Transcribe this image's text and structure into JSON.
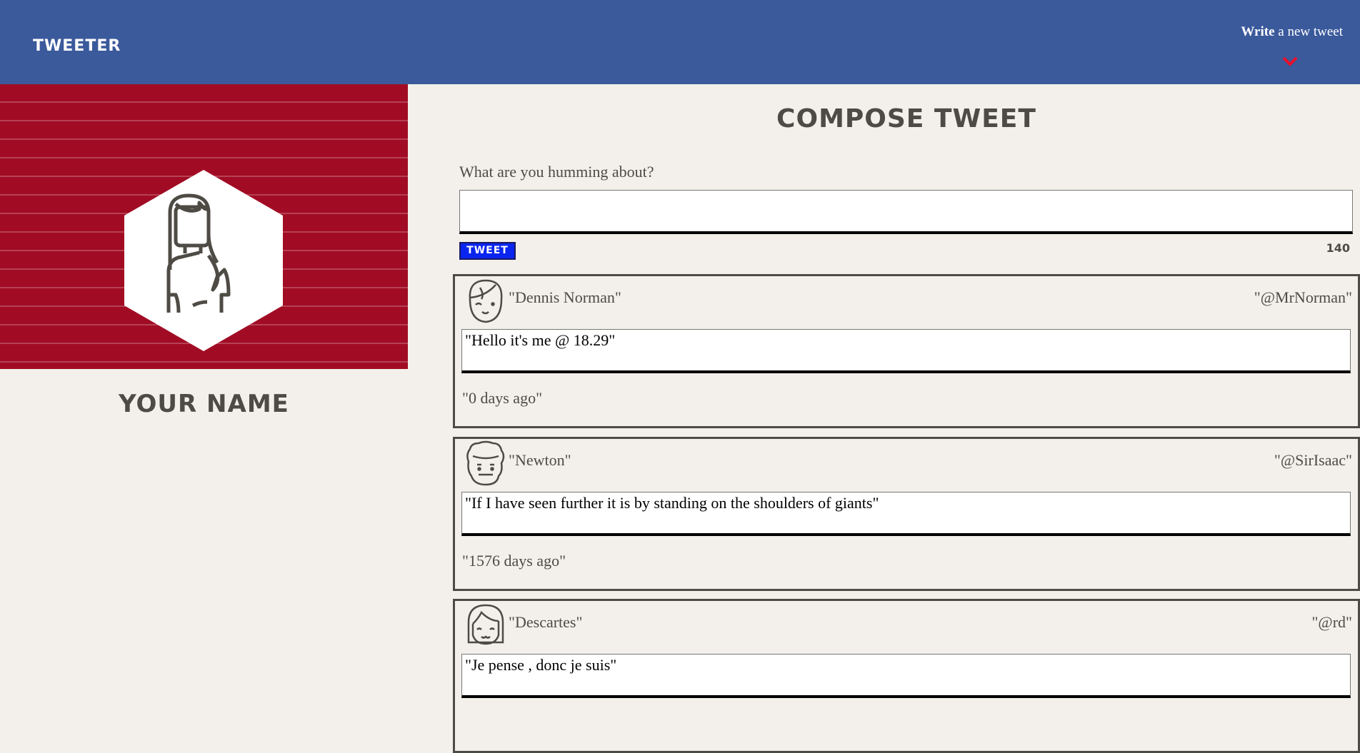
{
  "header": {
    "logo": "TWEETER",
    "write_bold": "Write",
    "write_rest": " a new tweet",
    "chevron_color": "#e8102a",
    "bg": "#3b5a9c"
  },
  "profile": {
    "name": "YOUR NAME",
    "bg": "#a10c24"
  },
  "compose": {
    "title": "COMPOSE TWEET",
    "label": "What are you humming about?",
    "value": "",
    "button": "TWEET",
    "char_count": "140"
  },
  "tweets": [
    {
      "name": "\"Dennis Norman\"",
      "handle": "\"@MrNorman\"",
      "text": "\"Hello it's me @ 18.29\"",
      "time": "\"0 days ago\"",
      "avatar": "boy-avatar-icon"
    },
    {
      "name": "\"Newton\"",
      "handle": "\"@SirIsaac\"",
      "text": "\"If I have seen further it is by standing on the shoulders of giants\"",
      "time": "\"1576 days ago\"",
      "avatar": "curly-hair-avatar-icon"
    },
    {
      "name": "\"Descartes\"",
      "handle": "\"@rd\"",
      "text": "\"Je pense , donc je suis\"",
      "time": "",
      "avatar": "bob-hair-avatar-icon"
    }
  ]
}
